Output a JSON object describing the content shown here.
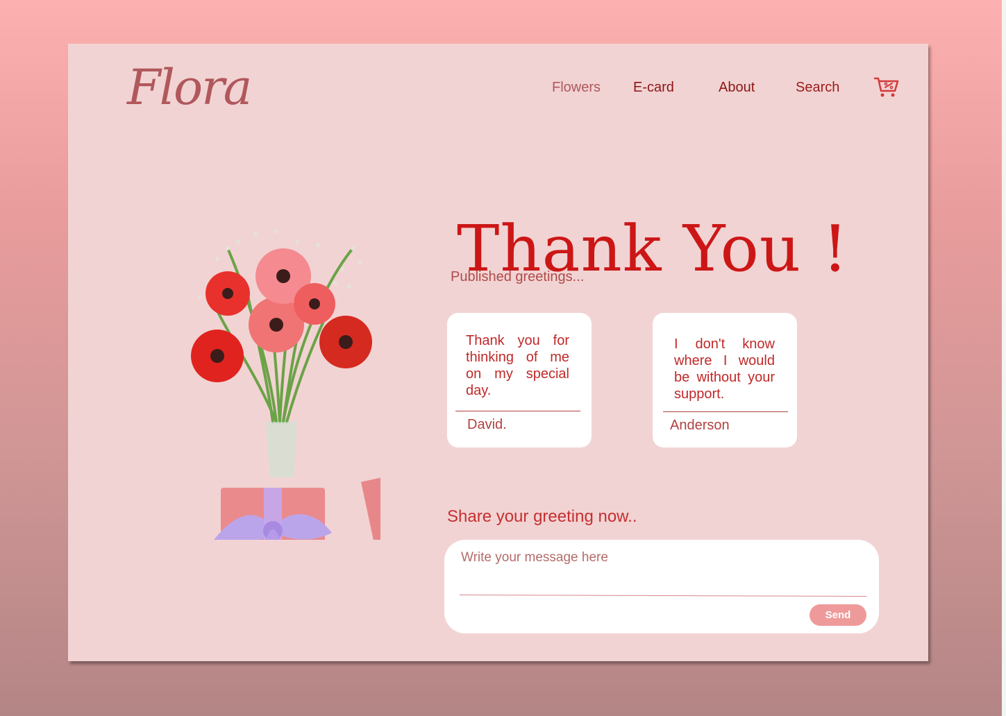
{
  "brand": {
    "logo": "Flora"
  },
  "nav": {
    "items": [
      {
        "label": "Flowers",
        "color": "#b0585c"
      },
      {
        "label": "E-card",
        "color": "#8c1515"
      },
      {
        "label": "About",
        "color": "#8c1515"
      },
      {
        "label": "Search",
        "color": "#9c1a1a"
      }
    ],
    "cart_icon": "cart-icon"
  },
  "hero": {
    "title": "Thank You !"
  },
  "greetings": {
    "heading": "Published greetings...",
    "cards": [
      {
        "message": "Thank you for thinking of me on my special day.",
        "author": "David."
      },
      {
        "message": "I don't know where I would be without your support.",
        "author": "Anderson"
      }
    ]
  },
  "share": {
    "heading": "Share your greeting now..",
    "placeholder": "Write your message here",
    "send_label": "Send"
  },
  "colors": {
    "accent": "#cc1616",
    "card_bg": "#f2d3d3",
    "button": "#ef9a9a"
  }
}
